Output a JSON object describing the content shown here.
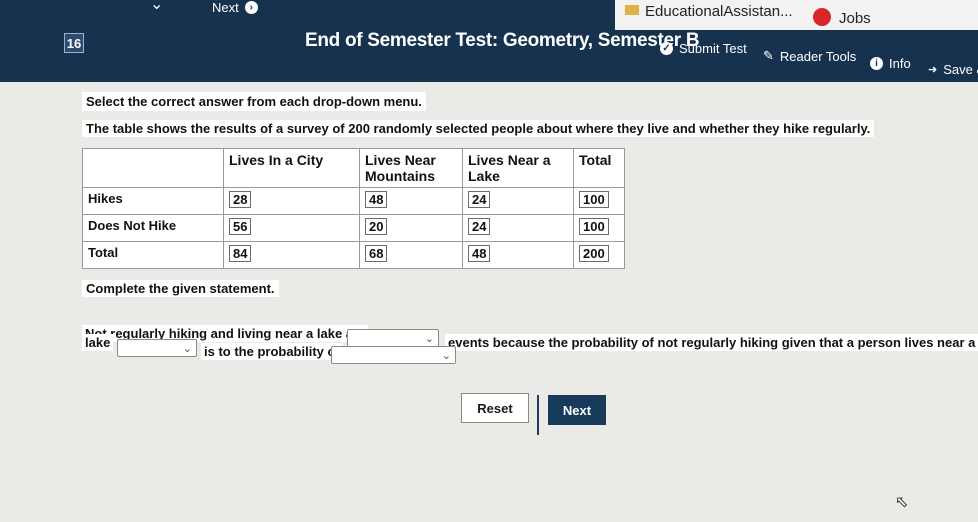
{
  "header": {
    "question_number": "16",
    "browser_next_label": "Next",
    "title": "End of Semester Test: Geometry, Semester B",
    "submit_label": "Submit Test",
    "reader_tools_label": "Reader Tools",
    "info_label": "Info",
    "save_label": "Save &",
    "tab_educational": "EducationalAssistan...",
    "tab_jobs": "Jobs"
  },
  "instruction": "Select the correct answer from each drop-down menu.",
  "intro": "The table shows the results of a survey of 200 randomly selected people about where they live and whether they hike regularly.",
  "table": {
    "headers": [
      "",
      "Lives In a City",
      "Lives Near Mountains",
      "Lives Near a Lake",
      "Total"
    ],
    "rows": [
      {
        "label": "Hikes",
        "values": [
          "28",
          "48",
          "24",
          "100"
        ]
      },
      {
        "label": "Does Not Hike",
        "values": [
          "56",
          "20",
          "24",
          "100"
        ]
      },
      {
        "label": "Total",
        "values": [
          "84",
          "68",
          "48",
          "200"
        ]
      }
    ]
  },
  "complete_label": "Complete the given statement.",
  "statement": {
    "part1": "Not regularly hiking and living near a lake are",
    "part2": "events because the probability of not regularly hiking given that a person lives near a",
    "part3": "lake",
    "part4": "is to the probability of"
  },
  "buttons": {
    "reset": "Reset",
    "next": "Next"
  }
}
